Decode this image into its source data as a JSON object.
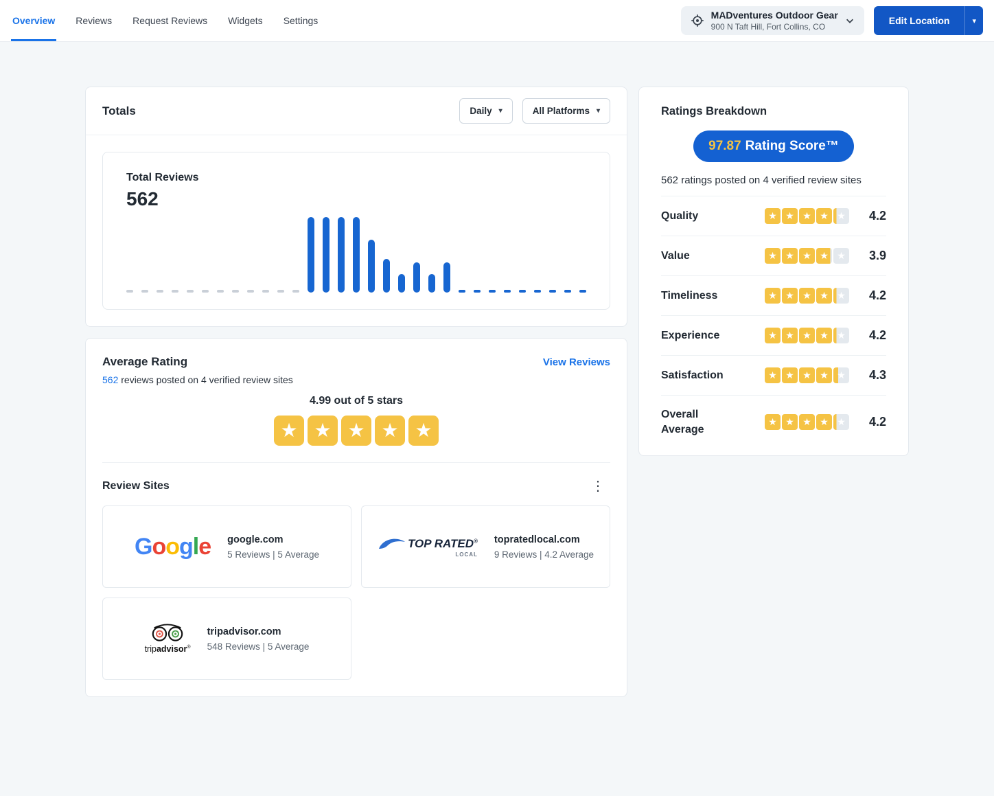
{
  "colors": {
    "accent_blue": "#1a73e8",
    "button_blue": "#1257c5",
    "pill_blue": "#1461d2",
    "bar_blue": "#1766d1",
    "star_yellow": "#f5c344",
    "star_empty": "#e4e9ee",
    "dash_gray": "#c9cfd7"
  },
  "nav": {
    "tabs": [
      {
        "label": "Overview",
        "active": true
      },
      {
        "label": "Reviews",
        "active": false
      },
      {
        "label": "Request Reviews",
        "active": false
      },
      {
        "label": "Widgets",
        "active": false
      },
      {
        "label": "Settings",
        "active": false
      }
    ],
    "location": {
      "name": "MADventures Outdoor Gear",
      "address": "900 N Taft Hill, Fort Collins, CO"
    },
    "edit_location_label": "Edit Location"
  },
  "totals": {
    "title": "Totals",
    "period_filter": "Daily",
    "platform_filter": "All Platforms",
    "total_reviews_label": "Total Reviews",
    "total_reviews_value": "562",
    "chart_data": {
      "type": "bar",
      "title": "Total Reviews over time (daily)",
      "values": [
        0,
        0,
        0,
        0,
        0,
        0,
        0,
        0,
        0,
        0,
        0,
        0,
        100,
        100,
        100,
        100,
        70,
        45,
        25,
        40,
        25,
        40,
        2,
        2,
        2,
        2,
        2,
        2,
        2,
        2,
        2
      ],
      "max": 100,
      "grid": false,
      "legend": "none",
      "note": "gray dashes = zero days, blue bars = review counts"
    }
  },
  "average_rating": {
    "title": "Average Rating",
    "view_reviews_label": "View Reviews",
    "count": "562",
    "summary_rest": " reviews posted on 4 verified review sites",
    "rating_text": "4.99 out of 5 stars",
    "stars_value": 5
  },
  "review_sites": {
    "title": "Review Sites",
    "sites": [
      {
        "logo": "google",
        "name": "google.com",
        "stats": "5 Reviews | 5 Average"
      },
      {
        "logo": "topratedlocal",
        "name": "topratedlocal.com",
        "stats": "9 Reviews | 4.2 Average"
      },
      {
        "logo": "tripadvisor",
        "name": "tripadvisor.com",
        "stats": "548 Reviews | 5 Average"
      }
    ]
  },
  "ratings_breakdown": {
    "title": "Ratings Breakdown",
    "score_value": "97.87",
    "score_label": "Rating Score™",
    "summary": "562 ratings posted on 4 verified review sites",
    "rows": [
      {
        "label": "Quality",
        "value": 4.2
      },
      {
        "label": "Value",
        "value": 3.9
      },
      {
        "label": "Timeliness",
        "value": 4.2
      },
      {
        "label": "Experience",
        "value": 4.2
      },
      {
        "label": "Satisfaction",
        "value": 4.3
      },
      {
        "label": "Overall Average",
        "value": 4.2
      }
    ]
  }
}
